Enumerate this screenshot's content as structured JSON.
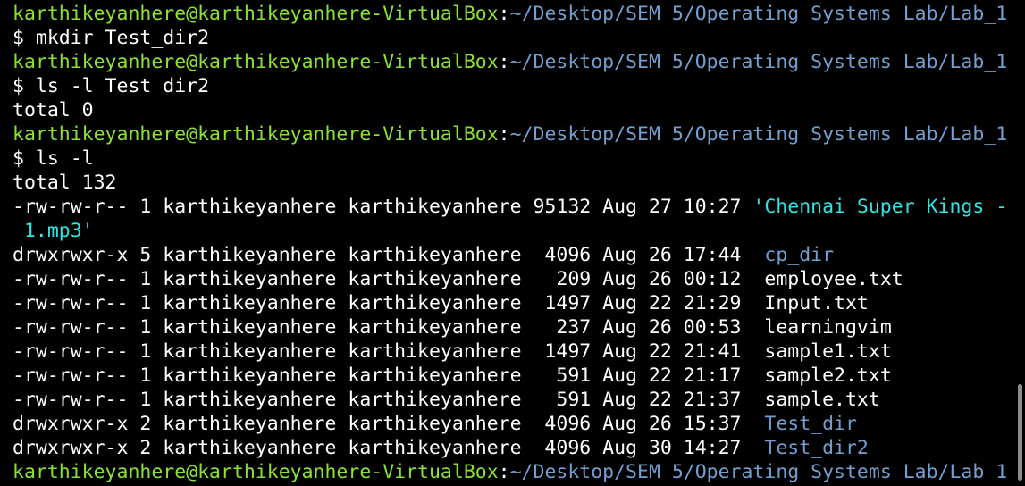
{
  "colors": {
    "background": "#000000",
    "prompt_user": "#8ae234",
    "prompt_path": "#729fcf",
    "directory": "#729fcf",
    "quoted_file": "#34e2e2",
    "text": "#ffffff"
  },
  "prompt": {
    "user_host": "karthikeyanhere@karthikeyanhere-VirtualBox",
    "separator": ":",
    "path": "~/Desktop/SEM 5/Operating Systems Lab/Lab_1"
  },
  "lines": [
    {
      "kind": "prompt"
    },
    {
      "kind": "cmd",
      "text": "$ mkdir Test_dir2"
    },
    {
      "kind": "prompt"
    },
    {
      "kind": "cmd",
      "text": "$ ls -l Test_dir2"
    },
    {
      "kind": "text",
      "text": "total 0"
    },
    {
      "kind": "prompt"
    },
    {
      "kind": "cmd",
      "text": "$ ls -l"
    },
    {
      "kind": "text",
      "text": "total 132"
    },
    {
      "kind": "entry",
      "meta": "-rw-rw-r-- 1 karthikeyanhere karthikeyanhere 95132 Aug 27 10:27 ",
      "name": "'Chennai Super Kings -",
      "style": "quote"
    },
    {
      "kind": "entry",
      "meta": " ",
      "name": "1.mp3'",
      "style": "quote"
    },
    {
      "kind": "entry",
      "meta": "drwxrwxr-x 5 karthikeyanhere karthikeyanhere  4096 Aug 26 17:44  ",
      "name": "cp_dir",
      "style": "dir"
    },
    {
      "kind": "entry",
      "meta": "-rw-rw-r-- 1 karthikeyanhere karthikeyanhere   209 Aug 26 00:12  ",
      "name": "employee.txt",
      "style": "plain"
    },
    {
      "kind": "entry",
      "meta": "-rw-rw-r-- 1 karthikeyanhere karthikeyanhere  1497 Aug 22 21:29  ",
      "name": "Input.txt",
      "style": "plain"
    },
    {
      "kind": "entry",
      "meta": "-rw-rw-r-- 1 karthikeyanhere karthikeyanhere   237 Aug 26 00:53  ",
      "name": "learningvim",
      "style": "plain"
    },
    {
      "kind": "entry",
      "meta": "-rw-rw-r-- 1 karthikeyanhere karthikeyanhere  1497 Aug 22 21:41  ",
      "name": "sample1.txt",
      "style": "plain"
    },
    {
      "kind": "entry",
      "meta": "-rw-rw-r-- 1 karthikeyanhere karthikeyanhere   591 Aug 22 21:17  ",
      "name": "sample2.txt",
      "style": "plain"
    },
    {
      "kind": "entry",
      "meta": "-rw-rw-r-- 1 karthikeyanhere karthikeyanhere   591 Aug 22 21:37  ",
      "name": "sample.txt",
      "style": "plain"
    },
    {
      "kind": "entry",
      "meta": "drwxrwxr-x 2 karthikeyanhere karthikeyanhere  4096 Aug 26 15:37  ",
      "name": "Test_dir",
      "style": "dir"
    },
    {
      "kind": "entry",
      "meta": "drwxrwxr-x 2 karthikeyanhere karthikeyanhere  4096 Aug 30 14:27  ",
      "name": "Test_dir2",
      "style": "dir"
    },
    {
      "kind": "prompt"
    }
  ]
}
